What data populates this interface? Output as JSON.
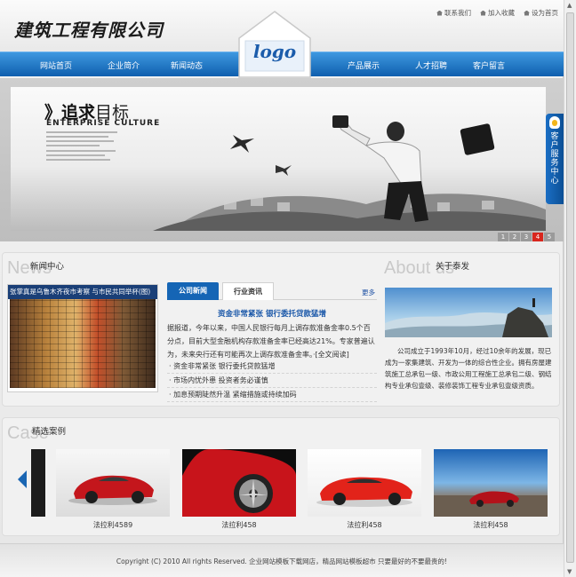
{
  "header": {
    "company_name": "建筑工程有限公司",
    "top_links": [
      "联系我们",
      "加入收藏",
      "设为首页"
    ],
    "logo_text": "logo"
  },
  "nav": {
    "left_items": [
      "网站首页",
      "企业简介",
      "新闻动态"
    ],
    "right_items": [
      "产品展示",
      "人才招聘",
      "客户留言"
    ]
  },
  "banner": {
    "title_bold": "》追求",
    "title_light": "目标",
    "subtitle": "ENTERPRISE CULTURE",
    "pager": [
      "1",
      "2",
      "3",
      "4",
      "5"
    ],
    "active_page": "4"
  },
  "service": {
    "label": "客户服务中心"
  },
  "news": {
    "bg_text": "News",
    "title": "新闻中心",
    "photo_caption": "张掌真是乌鲁木齐夜市考察 与市民共同举杯(图)",
    "tabs": [
      "公司新闻",
      "行业资讯"
    ],
    "more": "更多",
    "headline": "资金非常紧张 银行委托贷款猛增",
    "summary": "据报道，今年以来，中国人民银行每月上调存款准备金率0.5个百分点，目前大型金融机构存款准备金率已经高达21%。专家普遍认为，未来央行还有可能再次上调存款准备金率。·[全文阅读]",
    "items": [
      "· 资金非常紧张 银行委托贷款猛增",
      "· 市场内忧外患 投资者务必谨慎",
      "· 加息预期陡然升温 紧缩措施或持续加码"
    ]
  },
  "about": {
    "bg_text": "About us",
    "title": "关于泰发",
    "text": "公司成立于1993年10月，经过10余年的发展，现已成为一家集建筑、开发为一体的综合性企业。拥有房屋建筑施工总承包一级、市政公用工程施工总承包二级、钢结构专业承包壹级、装修装饰工程专业承包壹级资质。"
  },
  "cases": {
    "bg_text": "Case",
    "title": "精选案例",
    "items": [
      "法拉利4589",
      "法拉利458",
      "法拉利458",
      "法拉利458"
    ]
  },
  "footer": {
    "text": "Copyright (C) 2010 All rights Reserved. 企业网站模板下载网店，精品网站模板超市 只要最好的不要最贵的!"
  }
}
